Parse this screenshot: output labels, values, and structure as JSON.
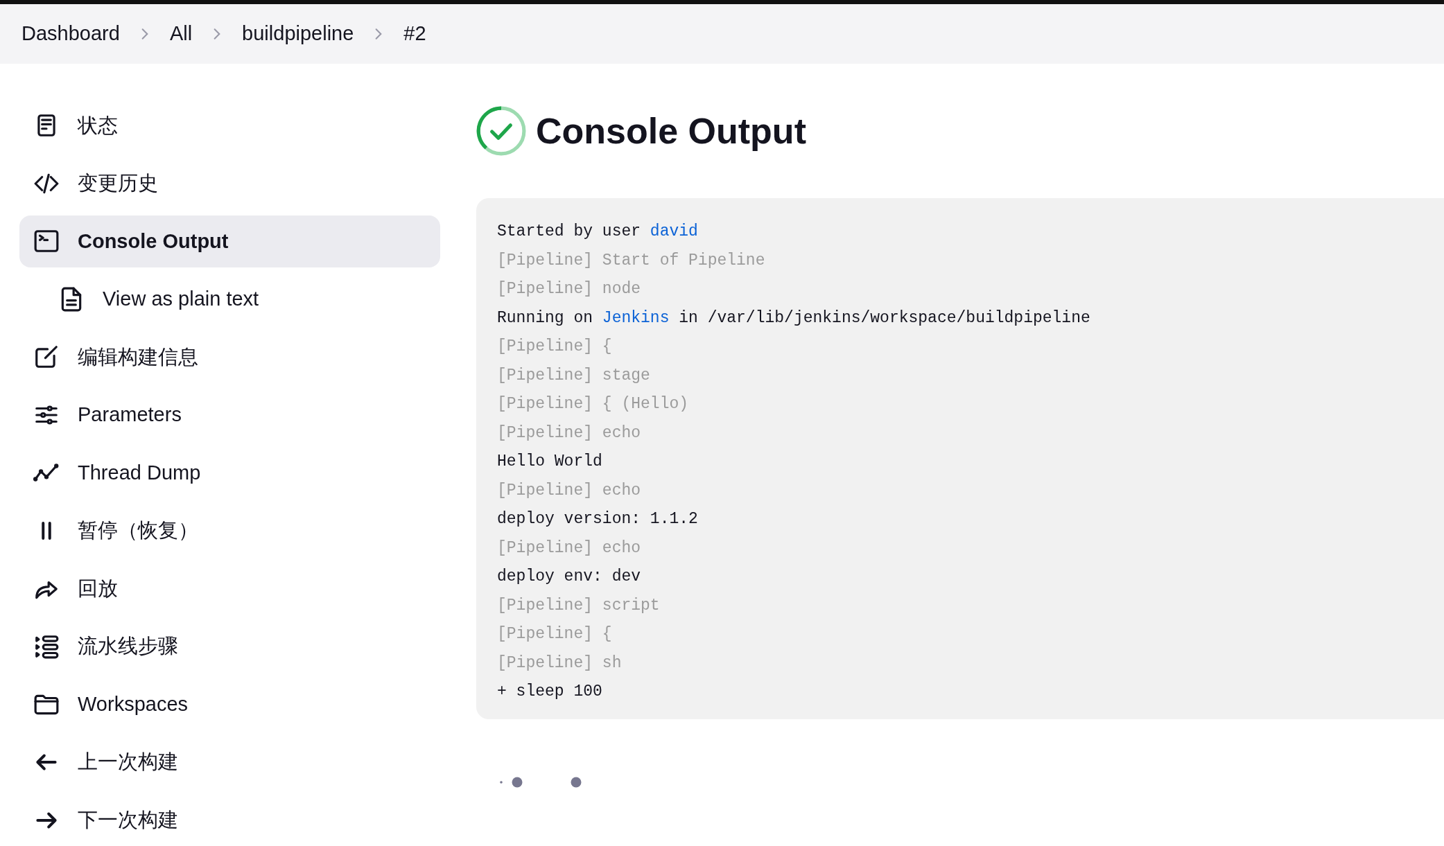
{
  "breadcrumbs": [
    "Dashboard",
    "All",
    "buildpipeline",
    "#2"
  ],
  "sidebar": {
    "items": [
      {
        "label": "状态",
        "selected": false
      },
      {
        "label": "变更历史",
        "selected": false
      },
      {
        "label": "Console Output",
        "selected": true,
        "children": [
          {
            "label": "View as plain text",
            "selected": false
          }
        ]
      },
      {
        "label": "编辑构建信息",
        "selected": false
      },
      {
        "label": "Parameters",
        "selected": false
      },
      {
        "label": "Thread Dump",
        "selected": false
      },
      {
        "label": "暂停（恢复）",
        "selected": false
      },
      {
        "label": "回放",
        "selected": false
      },
      {
        "label": "流水线步骤",
        "selected": false
      },
      {
        "label": "Workspaces",
        "selected": false
      },
      {
        "label": "上一次构建",
        "selected": false
      },
      {
        "label": "下一次构建",
        "selected": false
      }
    ]
  },
  "heading": {
    "title": "Console Output",
    "kind": "success"
  },
  "console": {
    "lines": [
      {
        "kind": "output",
        "parts": [
          {
            "text": "Started by user "
          },
          {
            "text": "david",
            "link": true
          }
        ]
      },
      {
        "kind": "pipeline",
        "parts": [
          {
            "text": "[Pipeline] Start of Pipeline"
          }
        ]
      },
      {
        "kind": "pipeline",
        "parts": [
          {
            "text": "[Pipeline] node"
          }
        ]
      },
      {
        "kind": "output",
        "parts": [
          {
            "text": "Running on "
          },
          {
            "text": "Jenkins",
            "link": true
          },
          {
            "text": " in /var/lib/jenkins/workspace/buildpipeline"
          }
        ]
      },
      {
        "kind": "pipeline",
        "parts": [
          {
            "text": "[Pipeline] {"
          }
        ]
      },
      {
        "kind": "pipeline",
        "parts": [
          {
            "text": "[Pipeline] stage"
          }
        ]
      },
      {
        "kind": "pipeline",
        "parts": [
          {
            "text": "[Pipeline] { (Hello)"
          }
        ]
      },
      {
        "kind": "pipeline",
        "parts": [
          {
            "text": "[Pipeline] echo"
          }
        ]
      },
      {
        "kind": "output",
        "parts": [
          {
            "text": "Hello World"
          }
        ]
      },
      {
        "kind": "pipeline",
        "parts": [
          {
            "text": "[Pipeline] echo"
          }
        ]
      },
      {
        "kind": "output",
        "parts": [
          {
            "text": "deploy version: 1.1.2"
          }
        ]
      },
      {
        "kind": "pipeline",
        "parts": [
          {
            "text": "[Pipeline] echo"
          }
        ]
      },
      {
        "kind": "output",
        "parts": [
          {
            "text": "deploy env: dev"
          }
        ]
      },
      {
        "kind": "pipeline",
        "parts": [
          {
            "text": "[Pipeline] script"
          }
        ]
      },
      {
        "kind": "pipeline",
        "parts": [
          {
            "text": "[Pipeline] {"
          }
        ]
      },
      {
        "kind": "pipeline",
        "parts": [
          {
            "text": "[Pipeline] sh"
          }
        ]
      },
      {
        "kind": "output",
        "parts": [
          {
            "text": "+ sleep 100"
          }
        ]
      }
    ]
  }
}
